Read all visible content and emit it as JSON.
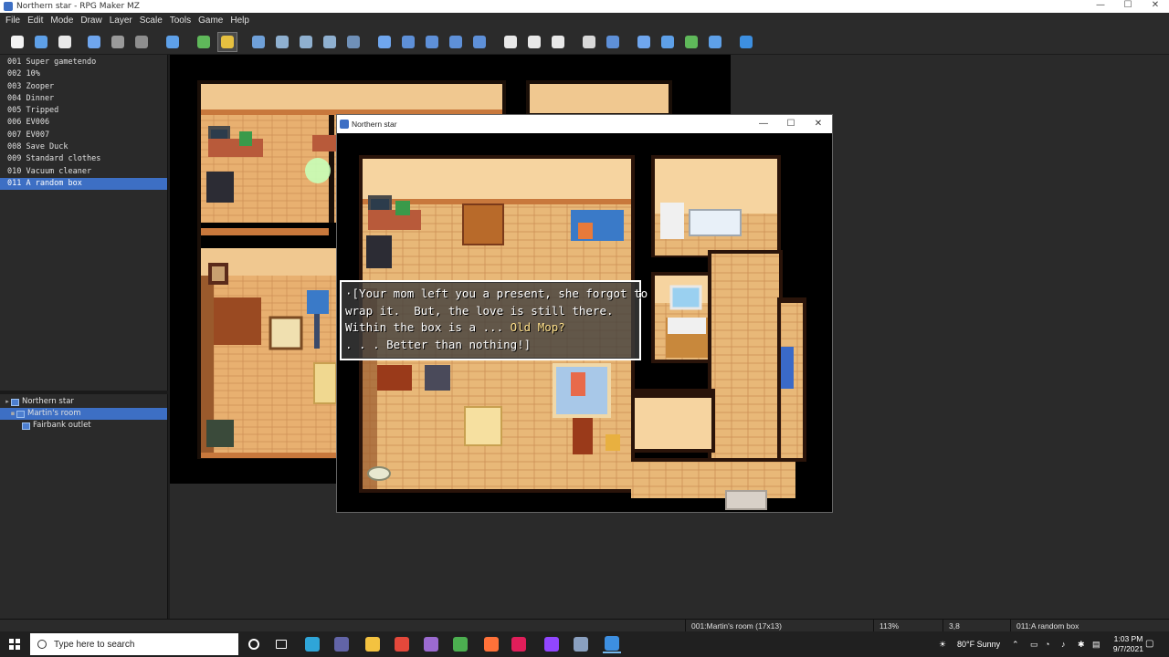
{
  "window": {
    "title": "Northern star - RPG Maker MZ"
  },
  "menu": [
    "File",
    "Edit",
    "Mode",
    "Draw",
    "Layer",
    "Scale",
    "Tools",
    "Game",
    "Help"
  ],
  "toolbar": {
    "buttons": [
      {
        "name": "new-project-icon",
        "color": "#f2f2f2"
      },
      {
        "name": "open-project-icon",
        "color": "#5ea0e8"
      },
      {
        "name": "save-project-icon",
        "color": "#e8e8e8"
      },
      {
        "name": "cut-icon",
        "color": "#6fa6ee"
      },
      {
        "name": "copy-icon",
        "color": "#9a9a9a"
      },
      {
        "name": "paste-icon",
        "color": "#8e8e8e"
      },
      {
        "name": "undo-icon",
        "color": "#5ea0e8"
      },
      {
        "name": "map-mode-icon",
        "color": "#5fb85a"
      },
      {
        "name": "event-mode-icon",
        "color": "#e6c040"
      },
      {
        "name": "layer-1-icon",
        "color": "#6fa0d8"
      },
      {
        "name": "layer-2-icon",
        "color": "#8fb0d0"
      },
      {
        "name": "layer-3-icon",
        "color": "#8fb0d0"
      },
      {
        "name": "layer-4-icon",
        "color": "#8fb0d0"
      },
      {
        "name": "layer-all-icon",
        "color": "#6f90b8"
      },
      {
        "name": "pencil-icon",
        "color": "#6fa6ee"
      },
      {
        "name": "rectangle-icon",
        "color": "#5e90d8"
      },
      {
        "name": "ellipse-icon",
        "color": "#5e90d8"
      },
      {
        "name": "fill-icon",
        "color": "#5e90d8"
      },
      {
        "name": "shadow-pen-icon",
        "color": "#5e90d8"
      },
      {
        "name": "zoom-in-icon",
        "color": "#e8e8e8"
      },
      {
        "name": "zoom-out-icon",
        "color": "#e8e8e8"
      },
      {
        "name": "zoom-reset-icon",
        "color": "#e8e8e8"
      },
      {
        "name": "database-icon",
        "color": "#d8d8d8"
      },
      {
        "name": "plugin-manager-icon",
        "color": "#5e90d8"
      },
      {
        "name": "sound-test-icon",
        "color": "#6fa6ee"
      },
      {
        "name": "event-searcher-icon",
        "color": "#5ea0e8"
      },
      {
        "name": "resource-manager-icon",
        "color": "#5fb85a"
      },
      {
        "name": "character-generator-icon",
        "color": "#5ea0e8"
      },
      {
        "name": "playtest-icon",
        "color": "#3d8fe0"
      }
    ]
  },
  "events": [
    "001 Super gametendo",
    "002 10%",
    "003 Zooper",
    "004 Dinner",
    "005 Tripped",
    "006 EV006",
    "007 EV007",
    "008 Save Duck",
    "009 Standard clothes",
    "010 Vacuum cleaner",
    "011 A random box"
  ],
  "selected_event_index": 10,
  "map_tree": [
    {
      "label": "Northern star",
      "level": 0,
      "toggle": "▸"
    },
    {
      "label": "Martin's room",
      "level": 1,
      "toggle": "▪",
      "selected": true
    },
    {
      "label": "Fairbank outlet",
      "level": 2,
      "toggle": ""
    }
  ],
  "status": {
    "map": "001:Martin's room (17x13)",
    "zoom": "113%",
    "coords": "3,8",
    "event": "011:A random box"
  },
  "game_window": {
    "title": "Northern star",
    "controls": [
      "—",
      "☐",
      "✕"
    ],
    "message_lines": [
      {
        "pre": "·[Your mom left you a present, she forgot to",
        "hl": "",
        "post": ""
      },
      {
        "pre": "wrap it.  But, the love is still there.",
        "hl": "",
        "post": ""
      },
      {
        "pre": "Within the box is a ... ",
        "hl": "Old Mop?",
        "post": ""
      },
      {
        "pre": ". . . Better than nothing!]",
        "hl": "",
        "post": ""
      }
    ]
  },
  "taskbar": {
    "search_placeholder": "Type here to search",
    "apps": [
      {
        "name": "cortana-icon",
        "color": "#202020"
      },
      {
        "name": "task-view-icon",
        "color": "#202020"
      },
      {
        "name": "edge-icon",
        "color": "#2fa5d8"
      },
      {
        "name": "teams-icon",
        "color": "#6264a7"
      },
      {
        "name": "file-explorer-icon",
        "color": "#f3c240"
      },
      {
        "name": "chrome-icon",
        "color": "#e4483b"
      },
      {
        "name": "app-purple-icon",
        "color": "#9b6ad0"
      },
      {
        "name": "app-green-icon",
        "color": "#4caf50"
      },
      {
        "name": "firefox-icon",
        "color": "#ff7139"
      },
      {
        "name": "slack-icon",
        "color": "#e01e5a"
      },
      {
        "name": "twitch-icon",
        "color": "#9146ff"
      },
      {
        "name": "rpg-maker-icon",
        "color": "#8aa0c0"
      },
      {
        "name": "vscode-icon",
        "color": "#3d8fe0"
      }
    ],
    "weather": "80°F  Sunny",
    "time": "1:03 PM",
    "date": "9/7/2021"
  }
}
